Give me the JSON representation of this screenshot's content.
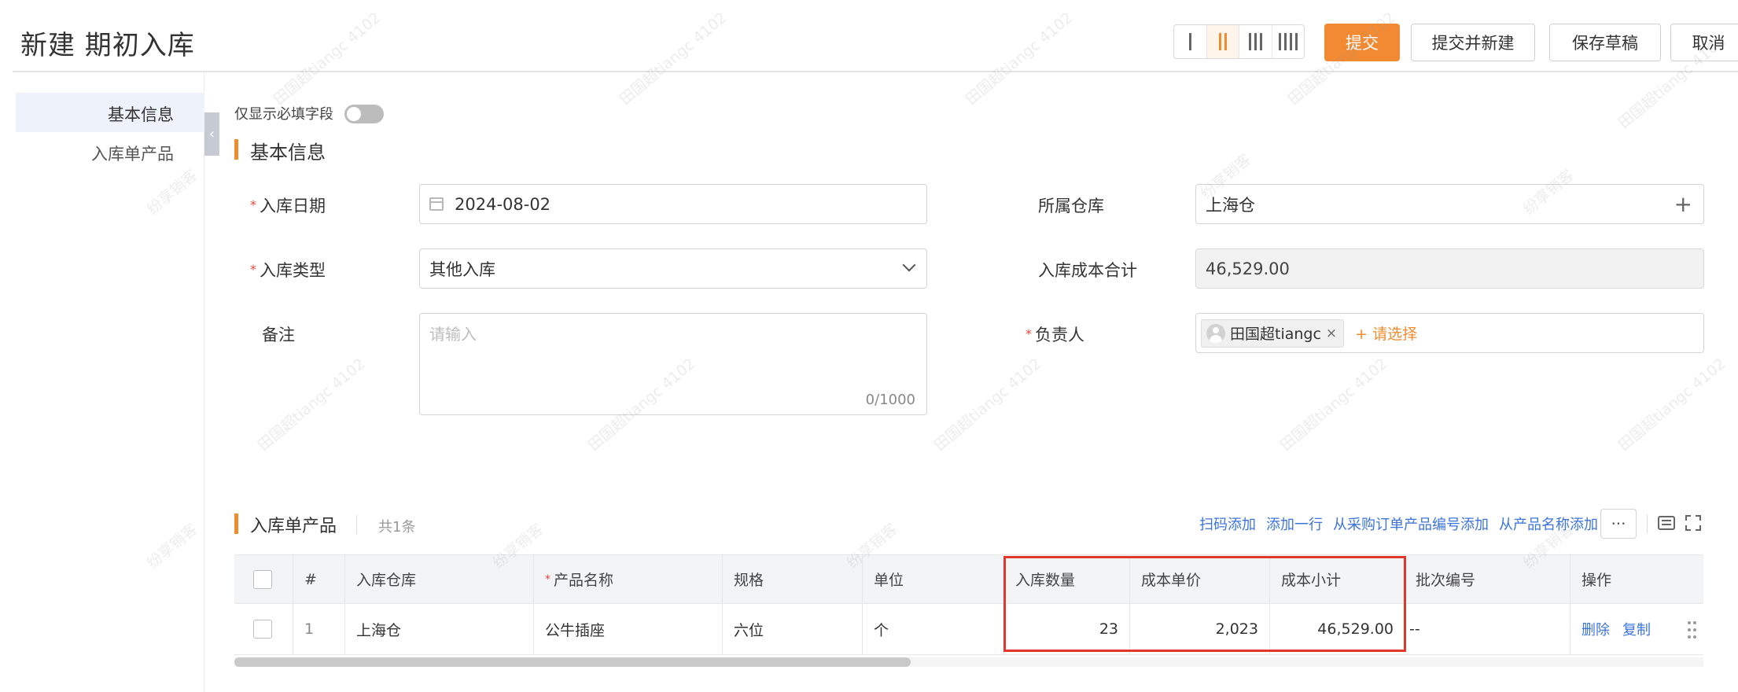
{
  "header": {
    "title": "新建 期初入库",
    "layout_options": [
      "1-col",
      "2-col",
      "3-col",
      "4-col"
    ],
    "layout_active": 1,
    "buttons": {
      "submit": "提交",
      "submit_new": "提交并新建",
      "save_draft": "保存草稿",
      "cancel": "取消"
    }
  },
  "sidebar": {
    "items": [
      {
        "label": "基本信息",
        "active": true
      },
      {
        "label": "入库单产品",
        "active": false
      }
    ]
  },
  "form": {
    "required_only_label": "仅显示必填字段",
    "required_only_on": false,
    "section_title": "基本信息",
    "date": {
      "label": "入库日期",
      "value": "2024-08-02",
      "required": true
    },
    "type": {
      "label": "入库类型",
      "value": "其他入库",
      "required": true
    },
    "remark": {
      "label": "备注",
      "placeholder": "请输入",
      "counter": "0/1000"
    },
    "warehouse": {
      "label": "所属仓库",
      "value": "上海仓"
    },
    "cost_total": {
      "label": "入库成本合计",
      "value": "46,529.00"
    },
    "owner": {
      "label": "负责人",
      "required": true,
      "tag": "田国超tiangc",
      "add_label": "+ 请选择"
    }
  },
  "products": {
    "section_title": "入库单产品",
    "count_label": "共1条",
    "actions": [
      "扫码添加",
      "添加一行",
      "从采购订单产品编号添加",
      "从产品名称添加"
    ],
    "more_label": "···",
    "columns": [
      "#",
      "入库仓库",
      "产品名称",
      "规格",
      "单位",
      "入库数量",
      "成本单价",
      "成本小计",
      "批次编号",
      "操作"
    ],
    "rows": [
      {
        "index": "1",
        "warehouse": "上海仓",
        "name": "公牛插座",
        "spec": "六位",
        "unit": "个",
        "qty": "23",
        "unit_cost": "2,023",
        "subtotal": "46,529.00",
        "batch": "--",
        "ops": [
          "删除",
          "复制"
        ]
      }
    ]
  },
  "watermark": {
    "text_a": "田国超tiangc 4102",
    "text_b": "纷享销客"
  },
  "colors": {
    "accent": "#f08c2f",
    "link": "#3d74d9",
    "required": "#e8453c",
    "highlight": "#e0382c"
  }
}
